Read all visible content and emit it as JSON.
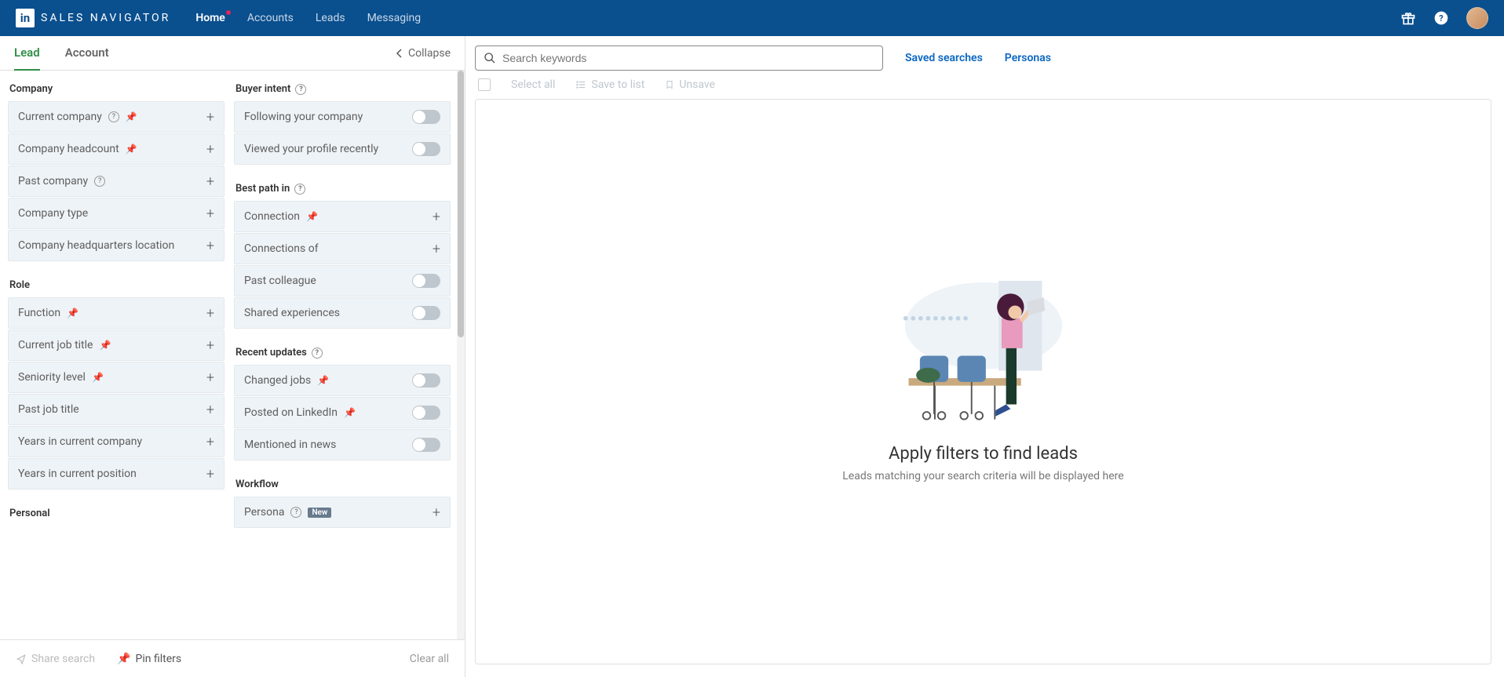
{
  "nav": {
    "brand": "SALES NAVIGATOR",
    "home": "Home",
    "accounts": "Accounts",
    "leads": "Leads",
    "messaging": "Messaging"
  },
  "tabs": {
    "lead": "Lead",
    "account": "Account",
    "collapse": "Collapse"
  },
  "sections": {
    "company": "Company",
    "role": "Role",
    "personal": "Personal",
    "buyer_intent": "Buyer intent",
    "best_path": "Best path in",
    "recent_updates": "Recent updates",
    "workflow": "Workflow"
  },
  "filters": {
    "current_company": "Current company",
    "company_headcount": "Company headcount",
    "past_company": "Past company",
    "company_type": "Company type",
    "company_hq": "Company headquarters location",
    "function": "Function",
    "current_job_title": "Current job title",
    "seniority_level": "Seniority level",
    "past_job_title": "Past job title",
    "years_company": "Years in current company",
    "years_position": "Years in current position",
    "following": "Following your company",
    "viewed_profile": "Viewed your profile recently",
    "connection": "Connection",
    "connections_of": "Connections of",
    "past_colleague": "Past colleague",
    "shared_exp": "Shared experiences",
    "changed_jobs": "Changed jobs",
    "posted_linkedin": "Posted on LinkedIn",
    "mentioned_news": "Mentioned in news",
    "persona": "Persona",
    "new_badge": "New"
  },
  "footer": {
    "share_search": "Share search",
    "pin_filters": "Pin filters",
    "clear_all": "Clear all"
  },
  "search": {
    "placeholder": "Search keywords",
    "saved": "Saved searches",
    "personas": "Personas"
  },
  "actions": {
    "select_all": "Select all",
    "save_to_list": "Save to list",
    "unsave": "Unsave"
  },
  "empty": {
    "title": "Apply filters to find leads",
    "subtitle": "Leads matching your search criteria will be displayed here"
  }
}
